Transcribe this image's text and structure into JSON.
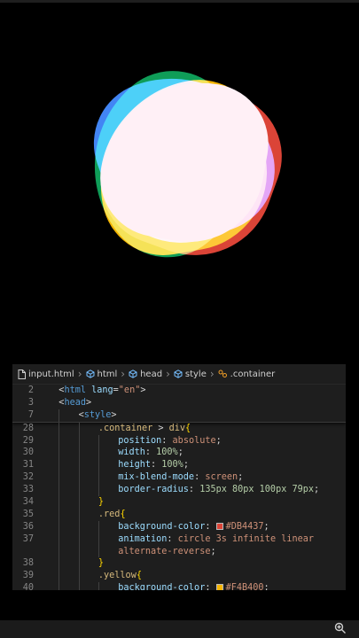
{
  "colors": {
    "red": "#DB4437",
    "yellow": "#F4B400",
    "green": "#0F9D58",
    "blue": "#4285F4",
    "center": "#FFF0F6"
  },
  "breadcrumb": {
    "file": "input.html",
    "items": [
      "html",
      "head",
      "style",
      ".container"
    ]
  },
  "sticky_lines": [
    {
      "num": "2",
      "indent": 1,
      "parts": [
        {
          "t": "<",
          "c": "punc"
        },
        {
          "t": "html",
          "c": "tag"
        },
        {
          "t": " lang",
          "c": "attr"
        },
        {
          "t": "=",
          "c": "punc"
        },
        {
          "t": "\"en\"",
          "c": "str"
        },
        {
          "t": ">",
          "c": "punc"
        }
      ]
    },
    {
      "num": "3",
      "indent": 1,
      "parts": [
        {
          "t": "<",
          "c": "punc"
        },
        {
          "t": "head",
          "c": "tag"
        },
        {
          "t": ">",
          "c": "punc"
        }
      ]
    },
    {
      "num": "7",
      "indent": 2,
      "parts": [
        {
          "t": "<",
          "c": "punc"
        },
        {
          "t": "style",
          "c": "tag"
        },
        {
          "t": ">",
          "c": "punc"
        }
      ]
    }
  ],
  "code_lines": [
    {
      "num": "28",
      "indent": 3,
      "parts": [
        {
          "t": ".container",
          "c": "sel"
        },
        {
          "t": " > ",
          "c": "punc"
        },
        {
          "t": "div",
          "c": "sel"
        },
        {
          "t": "{",
          "c": "brace"
        }
      ]
    },
    {
      "num": "29",
      "indent": 4,
      "parts": [
        {
          "t": "position",
          "c": "prop"
        },
        {
          "t": ": ",
          "c": "punc"
        },
        {
          "t": "absolute",
          "c": "val"
        },
        {
          "t": ";",
          "c": "punc"
        }
      ]
    },
    {
      "num": "30",
      "indent": 4,
      "parts": [
        {
          "t": "width",
          "c": "prop"
        },
        {
          "t": ": ",
          "c": "punc"
        },
        {
          "t": "100%",
          "c": "num"
        },
        {
          "t": ";",
          "c": "punc"
        }
      ]
    },
    {
      "num": "31",
      "indent": 4,
      "parts": [
        {
          "t": "height",
          "c": "prop"
        },
        {
          "t": ": ",
          "c": "punc"
        },
        {
          "t": "100%",
          "c": "num"
        },
        {
          "t": ";",
          "c": "punc"
        }
      ]
    },
    {
      "num": "32",
      "indent": 4,
      "parts": [
        {
          "t": "mix-blend-mode",
          "c": "prop"
        },
        {
          "t": ": ",
          "c": "punc"
        },
        {
          "t": "screen",
          "c": "val"
        },
        {
          "t": ";",
          "c": "punc"
        }
      ]
    },
    {
      "num": "33",
      "indent": 4,
      "parts": [
        {
          "t": "border-radius",
          "c": "prop"
        },
        {
          "t": ": ",
          "c": "punc"
        },
        {
          "t": "135px 80px 100px 79px",
          "c": "num"
        },
        {
          "t": ";",
          "c": "punc"
        }
      ]
    },
    {
      "num": "34",
      "indent": 3,
      "parts": [
        {
          "t": "}",
          "c": "brace"
        }
      ]
    },
    {
      "num": "35",
      "indent": 3,
      "parts": [
        {
          "t": ".red",
          "c": "sel"
        },
        {
          "t": "{",
          "c": "brace"
        }
      ]
    },
    {
      "num": "36",
      "indent": 4,
      "parts": [
        {
          "t": "background-color",
          "c": "prop"
        },
        {
          "t": ": ",
          "c": "punc"
        },
        {
          "t": "#DB4437",
          "c": "val",
          "swatch": "#DB4437"
        },
        {
          "t": ";",
          "c": "punc"
        }
      ]
    },
    {
      "num": "37",
      "indent": 4,
      "parts": [
        {
          "t": "animation",
          "c": "prop"
        },
        {
          "t": ": ",
          "c": "punc"
        },
        {
          "t": "circle 3s infinite linear",
          "c": "val"
        }
      ]
    },
    {
      "num": "",
      "indent": 4,
      "parts": [
        {
          "t": "alternate-reverse",
          "c": "val"
        },
        {
          "t": ";",
          "c": "punc"
        }
      ]
    },
    {
      "num": "38",
      "indent": 3,
      "parts": [
        {
          "t": "}",
          "c": "brace"
        }
      ]
    },
    {
      "num": "39",
      "indent": 3,
      "parts": [
        {
          "t": ".yellow",
          "c": "sel"
        },
        {
          "t": "{",
          "c": "brace"
        }
      ]
    },
    {
      "num": "40",
      "indent": 4,
      "parts": [
        {
          "t": "background-color",
          "c": "prop"
        },
        {
          "t": ": ",
          "c": "punc"
        },
        {
          "t": "#F4B400",
          "c": "val",
          "swatch": "#F4B400"
        },
        {
          "t": ";",
          "c": "punc"
        }
      ]
    }
  ]
}
